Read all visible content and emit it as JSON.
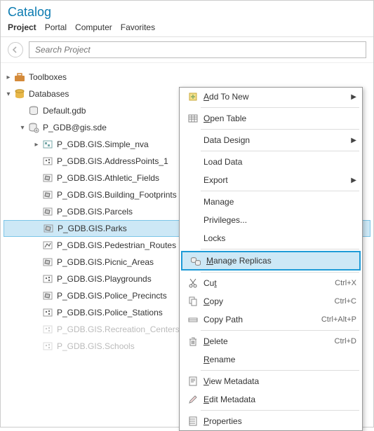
{
  "title": "Catalog",
  "tabs": [
    "Project",
    "Portal",
    "Computer",
    "Favorites"
  ],
  "active_tab": 0,
  "search": {
    "placeholder": "Search Project"
  },
  "tree": {
    "top": [
      {
        "label": "Toolboxes",
        "expanded": false,
        "icon": "toolbox"
      },
      {
        "label": "Databases",
        "expanded": true,
        "icon": "database"
      }
    ],
    "db_children": [
      {
        "label": "Default.gdb",
        "icon": "gdb",
        "expandable": false
      },
      {
        "label": "P_GDB@gis.sde",
        "icon": "sde",
        "expandable": true,
        "expanded": true
      }
    ],
    "sde_children": [
      {
        "label": "P_GDB.GIS.Simple_nva",
        "icon": "dataset",
        "expandable": true,
        "expanded": false,
        "selected": false,
        "faded": false
      },
      {
        "label": "P_GDB.GIS.AddressPoints_1",
        "icon": "point-fc",
        "selected": false
      },
      {
        "label": "P_GDB.GIS.Athletic_Fields",
        "icon": "polygon-fc",
        "selected": false
      },
      {
        "label": "P_GDB.GIS.Building_Footprints",
        "icon": "polygon-fc",
        "selected": false
      },
      {
        "label": "P_GDB.GIS.Parcels",
        "icon": "polygon-fc",
        "selected": false
      },
      {
        "label": "P_GDB.GIS.Parks",
        "icon": "polygon-fc",
        "selected": true
      },
      {
        "label": "P_GDB.GIS.Pedestrian_Routes",
        "icon": "line-fc",
        "selected": false
      },
      {
        "label": "P_GDB.GIS.Picnic_Areas",
        "icon": "polygon-fc",
        "selected": false
      },
      {
        "label": "P_GDB.GIS.Playgrounds",
        "icon": "point-fc",
        "selected": false
      },
      {
        "label": "P_GDB.GIS.Police_Precincts",
        "icon": "polygon-fc",
        "selected": false
      },
      {
        "label": "P_GDB.GIS.Police_Stations",
        "icon": "point-fc",
        "selected": false
      },
      {
        "label": "P_GDB.GIS.Recreation_Centers",
        "icon": "point-fc",
        "selected": false,
        "faded": true
      },
      {
        "label": "P_GDB.GIS.Schools",
        "icon": "point-fc",
        "selected": false,
        "faded": true
      }
    ]
  },
  "context_menu": [
    {
      "type": "item",
      "label": "Add To New",
      "icon": "add-map",
      "submenu": true,
      "ul_idx": 0
    },
    {
      "type": "sep"
    },
    {
      "type": "item",
      "label": "Open Table",
      "icon": "table",
      "ul_idx": 0
    },
    {
      "type": "sep"
    },
    {
      "type": "item",
      "label": "Data Design",
      "submenu": true
    },
    {
      "type": "sep"
    },
    {
      "type": "item",
      "label": "Load Data"
    },
    {
      "type": "item",
      "label": "Export",
      "submenu": true
    },
    {
      "type": "sep"
    },
    {
      "type": "item",
      "label": "Manage"
    },
    {
      "type": "item",
      "label": "Privileges..."
    },
    {
      "type": "item",
      "label": "Locks"
    },
    {
      "type": "sep"
    },
    {
      "type": "item",
      "label": "Manage Replicas",
      "icon": "replicas",
      "ul_idx": 0,
      "highlight": true
    },
    {
      "type": "sep"
    },
    {
      "type": "item",
      "label": "Cut",
      "icon": "cut",
      "hotkey": "Ctrl+X",
      "ul_prefix": 2
    },
    {
      "type": "item",
      "label": "Copy",
      "icon": "copy",
      "hotkey": "Ctrl+C",
      "ul_idx": 0
    },
    {
      "type": "item",
      "label": "Copy Path",
      "icon": "copy-path",
      "hotkey": "Ctrl+Alt+P",
      "ul_text": "Copy Path"
    },
    {
      "type": "sep"
    },
    {
      "type": "item",
      "label": "Delete",
      "icon": "delete",
      "hotkey": "Ctrl+D",
      "ul_idx": 0
    },
    {
      "type": "item",
      "label": "Rename",
      "ul_idx": 0
    },
    {
      "type": "sep"
    },
    {
      "type": "item",
      "label": "View Metadata",
      "icon": "view-meta",
      "ul_idx": 0
    },
    {
      "type": "item",
      "label": "Edit Metadata",
      "icon": "edit",
      "ul_idx": 0
    },
    {
      "type": "sep"
    },
    {
      "type": "item",
      "label": "Properties",
      "icon": "props",
      "ul_idx": 0
    }
  ]
}
